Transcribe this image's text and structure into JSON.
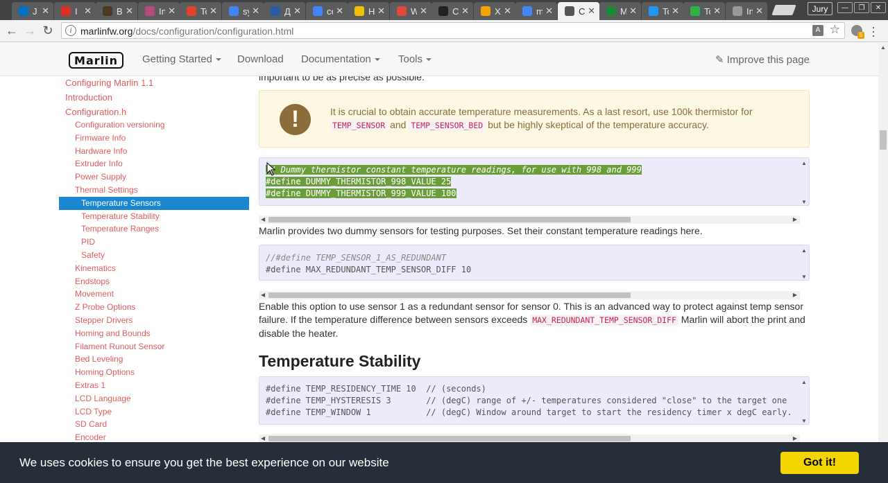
{
  "browser": {
    "tabs": [
      {
        "label": "J",
        "favicon_color": "#0072c6",
        "active": false
      },
      {
        "label": "I",
        "favicon_color": "#d93025",
        "active": false
      },
      {
        "label": "Bas",
        "favicon_color": "#4b3a1f",
        "active": false
      },
      {
        "label": "InM",
        "favicon_color": "#b44b7a",
        "active": false
      },
      {
        "label": "Tod",
        "favicon_color": "#e24329",
        "active": false
      },
      {
        "label": "syst",
        "favicon_color": "#4285f4",
        "active": false
      },
      {
        "label": "Диа",
        "favicon_color": "#2d5aa6",
        "active": false
      },
      {
        "label": "сер",
        "favicon_color": "#4285f4",
        "active": false
      },
      {
        "label": "Hov",
        "favicon_color": "#f2c200",
        "active": false
      },
      {
        "label": "Wel",
        "favicon_color": "#e0483e",
        "active": false
      },
      {
        "label": "Сер",
        "favicon_color": "#222222",
        "active": false
      },
      {
        "label": "Xen",
        "favicon_color": "#f4a300",
        "active": false
      },
      {
        "label": "mar",
        "favicon_color": "#4285f4",
        "active": false
      },
      {
        "label": "C",
        "favicon_color": "#555555",
        "active": true
      },
      {
        "label": "Mar",
        "favicon_color": "#1a8a3a",
        "active": false
      },
      {
        "label": "Toy",
        "favicon_color": "#2196f3",
        "active": false
      },
      {
        "label": "Toy",
        "favicon_color": "#2fb344",
        "active": false
      },
      {
        "label": "Inst",
        "favicon_color": "#999999",
        "active": false
      }
    ],
    "profile_name": "Jury",
    "url_domain": "marlinfw.org",
    "url_path": "/docs/configuration/configuration.html",
    "extension_badge": "5"
  },
  "site": {
    "logo_text": "Marlin",
    "nav": [
      {
        "label": "Getting Started",
        "dropdown": true
      },
      {
        "label": "Download",
        "dropdown": false
      },
      {
        "label": "Documentation",
        "dropdown": true
      },
      {
        "label": "Tools",
        "dropdown": true
      }
    ],
    "improve_label": "Improve this page"
  },
  "sidebar": {
    "items": [
      {
        "label": "Configuring Marlin 1.1",
        "level": 0
      },
      {
        "label": "Introduction",
        "level": 0
      },
      {
        "label": "Configuration.h",
        "level": 0
      },
      {
        "label": "Configuration versioning",
        "level": 1
      },
      {
        "label": "Firmware Info",
        "level": 1
      },
      {
        "label": "Hardware Info",
        "level": 1
      },
      {
        "label": "Extruder Info",
        "level": 1
      },
      {
        "label": "Power Supply",
        "level": 1
      },
      {
        "label": "Thermal Settings",
        "level": 1
      },
      {
        "label": "Temperature Sensors",
        "level": 2,
        "active": true
      },
      {
        "label": "Temperature Stability",
        "level": 2
      },
      {
        "label": "Temperature Ranges",
        "level": 2
      },
      {
        "label": "PID",
        "level": 2
      },
      {
        "label": "Safety",
        "level": 2
      },
      {
        "label": "Kinematics",
        "level": 1
      },
      {
        "label": "Endstops",
        "level": 1
      },
      {
        "label": "Movement",
        "level": 1
      },
      {
        "label": "Z Probe Options",
        "level": 1
      },
      {
        "label": "Stepper Drivers",
        "level": 1
      },
      {
        "label": "Homing and Bounds",
        "level": 1
      },
      {
        "label": "Filament Runout Sensor",
        "level": 1
      },
      {
        "label": "Bed Leveling",
        "level": 1
      },
      {
        "label": "Homing Options",
        "level": 1
      },
      {
        "label": "Extras 1",
        "level": 1
      },
      {
        "label": "LCD Language",
        "level": 1
      },
      {
        "label": "LCD Type",
        "level": 1
      },
      {
        "label": "SD Card",
        "level": 1
      },
      {
        "label": "Encoder",
        "level": 1
      }
    ]
  },
  "content": {
    "intro_tail": "important to be as precise as possible.",
    "callout": {
      "text_1": "It is crucial to obtain accurate temperature measurements. As a last resort, use 100k thermistor for",
      "code_1": "TEMP_SENSOR",
      "text_2": "and",
      "code_2": "TEMP_SENSOR_BED",
      "text_3": "but be highly skeptical of the temperature accuracy."
    },
    "code1": {
      "line1": "// Dummy thermistor constant temperature readings, for use with 998 and 999",
      "line2": "#define DUMMY_THERMISTOR_998_VALUE 25",
      "line3": "#define DUMMY_THERMISTOR_999_VALUE 100"
    },
    "para1": "Marlin provides two dummy sensors for testing purposes. Set their constant temperature readings here.",
    "code2": {
      "line1": "//#define TEMP_SENSOR_1_AS_REDUNDANT",
      "line2": "#define MAX_REDUNDANT_TEMP_SENSOR_DIFF 10"
    },
    "para2": {
      "text_1": "Enable this option to use sensor 1 as a redundant sensor for sensor 0. This is an advanced way to protect against temp sensor failure. If the temperature difference between sensors exceeds",
      "code": "MAX_REDUNDANT_TEMP_SENSOR_DIFF",
      "text_2": "Marlin will abort the print and disable the heater."
    },
    "section_title": "Temperature Stability",
    "code3": {
      "line1": "#define TEMP_RESIDENCY_TIME 10  // (seconds)",
      "line2": "#define TEMP_HYSTERESIS 3       // (degC) range of +/- temperatures considered \"close\" to the target one",
      "line3": "#define TEMP_WINDOW 1           // (degC) Window around target to start the residency timer x degC early."
    }
  },
  "cookie": {
    "message": "We uses cookies to ensure you get the best experience on our website",
    "button": "Got it!"
  }
}
